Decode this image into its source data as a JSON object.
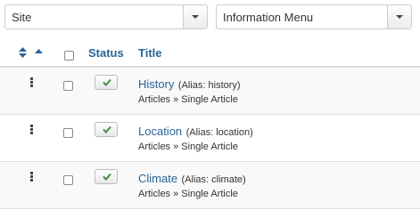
{
  "filters": {
    "site": "Site",
    "menu": "Information Menu"
  },
  "columns": {
    "status": "Status",
    "title": "Title"
  },
  "rows": [
    {
      "title": "History",
      "alias": "(Alias: history)",
      "type": "Articles » Single Article",
      "published": true
    },
    {
      "title": "Location",
      "alias": "(Alias: location)",
      "type": "Articles » Single Article",
      "published": true
    },
    {
      "title": "Climate",
      "alias": "(Alias: climate)",
      "type": "Articles » Single Article",
      "published": true
    }
  ],
  "colors": {
    "link": "#2a6496",
    "check": "#3c8f3c"
  }
}
